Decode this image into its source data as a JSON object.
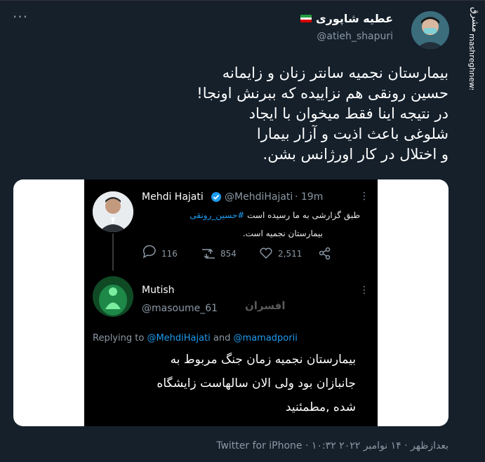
{
  "tweet": {
    "author_name": "عطیه شاپوری",
    "author_handle": "@atieh_shapuri",
    "more_label": "···",
    "text_lines": [
      "بیمارستان نجمیه سانتر زنان و زایمانه",
      "حسین رونقی هم نزاییده که ببرنش اونجا!",
      "در نتیجه اینا فقط میخوان با ایجاد",
      "شلوغی باعث اذیت و آزار بیمارا",
      "و اختلال در کار اورژانس بشن."
    ],
    "footer_time": "۱۰:۳۲ بعدازظهر · ۱۴ نوامبر ۲۰۲۲",
    "footer_source": "Twitter for iPhone",
    "footer_sep": " · "
  },
  "watermark": {
    "text": "mashreghnews.ir",
    "logo_text": "مشرق"
  },
  "embedded": {
    "first": {
      "name": "Mehdi Hajati",
      "handle": "@MehdiHajati",
      "time": "· 19m",
      "text_line1_prefix": "طبق گزارشی به ما رسیده است ",
      "hashtag": "#حسین_رونقی",
      "text_line2": "بیمارستان نجمیه است.",
      "replies": "116",
      "retweets": "854",
      "likes": "2,511"
    },
    "second": {
      "name": "Mutish",
      "handle": "@masoume_61",
      "replying_prefix": "Replying to ",
      "replying_user1": "@MehdiHajati",
      "replying_and": " and ",
      "replying_user2": "@mamadporii",
      "text_lines": [
        "بیمارستان نجمیه زمان جنگ مربوط به",
        "جانبازان بود ولی الان سالهاست زایشگاه",
        "شده ,مطمئنید"
      ],
      "stamp": "افسران"
    }
  },
  "colors": {
    "background": "#15202b",
    "secondary_text": "#8b98a5",
    "link": "#1d9bf0",
    "verified": "#1d9bf0"
  }
}
